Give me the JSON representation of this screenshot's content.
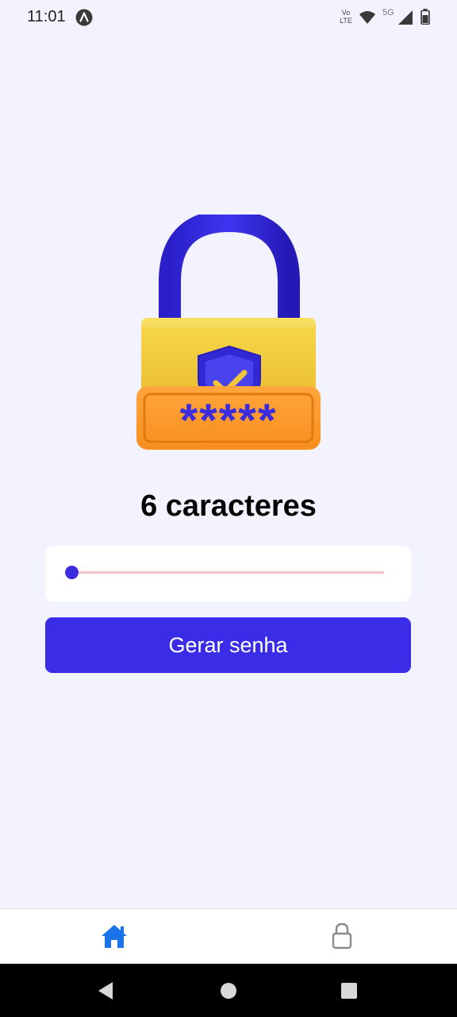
{
  "status_bar": {
    "time": "11:01",
    "network_type": "5G",
    "volte_label_top": "Vo",
    "volte_label_bottom": "LTE"
  },
  "main": {
    "illustration_icon": "padlock-password-icon",
    "lock_code": "*****",
    "length_label": "6 caracteres",
    "slider": {
      "value": 6,
      "accent_color": "#3b2ce0",
      "track_color": "#f3c1c6"
    },
    "generate_button_label": "Gerar senha",
    "accent_color": "#3b2ce8"
  },
  "tab_bar": {
    "tabs": [
      {
        "icon": "home-icon",
        "active": true,
        "color": "#1a73e8"
      },
      {
        "icon": "lock-icon",
        "active": false,
        "color": "#8a8a8a"
      }
    ]
  },
  "nav_bar": {
    "buttons": [
      "back-icon",
      "home-circle-icon",
      "recents-icon"
    ]
  }
}
